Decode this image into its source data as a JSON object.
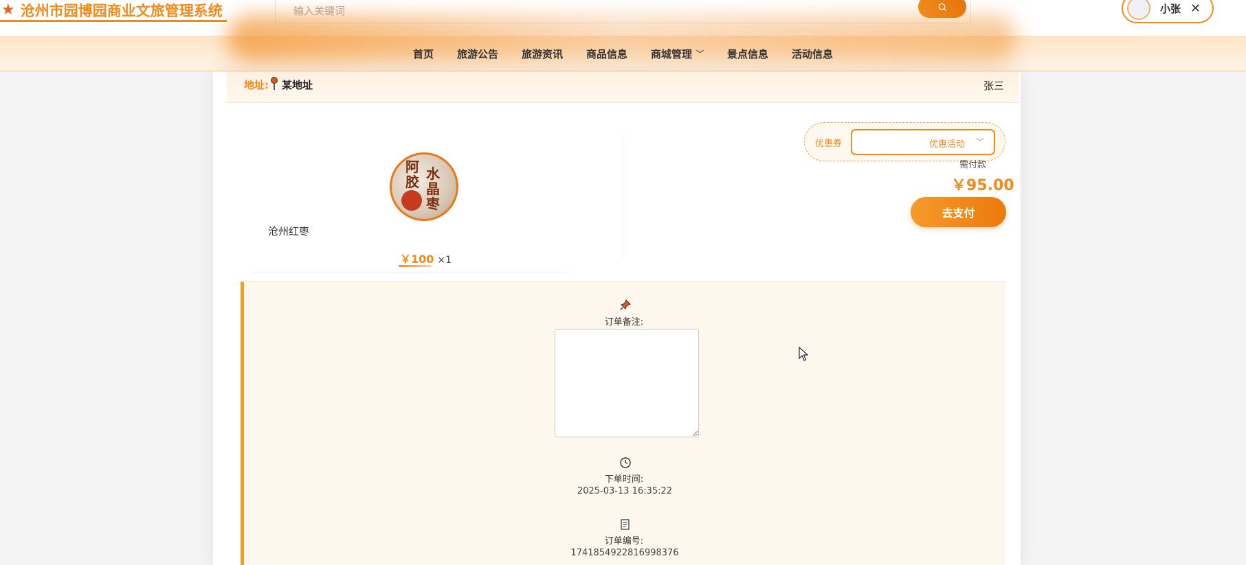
{
  "header": {
    "site_title": "沧州市园博园商业文旅管理系统",
    "search_placeholder": "输入关键词",
    "user_name": "小张"
  },
  "nav": {
    "items": [
      {
        "label": "首页"
      },
      {
        "label": "旅游公告"
      },
      {
        "label": "旅游资讯"
      },
      {
        "label": "商品信息"
      },
      {
        "label": "商城管理",
        "has_dropdown": true
      },
      {
        "label": "景点信息"
      },
      {
        "label": "活动信息"
      }
    ]
  },
  "address": {
    "label": "地址:",
    "value": "某地址",
    "recipient": "张三"
  },
  "product": {
    "name": "沧州红枣",
    "price": "￥100",
    "quantity": "×1",
    "image_text": [
      "阿",
      "胶",
      "水",
      "晶",
      "枣"
    ]
  },
  "payment": {
    "coupon_label": "优惠券",
    "coupon_value": "优惠活动",
    "due_label": "需付款",
    "total": "￥95.00",
    "pay_button": "去支付"
  },
  "order": {
    "remark_label": "订单备注:",
    "time_label": "下单时间:",
    "time_value": "2025-03-13 16:35:22",
    "number_label": "订单编号:",
    "number_value": "1741854922816998376"
  },
  "colors": {
    "accent": "#f08a1c",
    "accent_dark": "#e4740b",
    "detail_bg": "#fef7ee",
    "detail_border": "#f0a020"
  }
}
